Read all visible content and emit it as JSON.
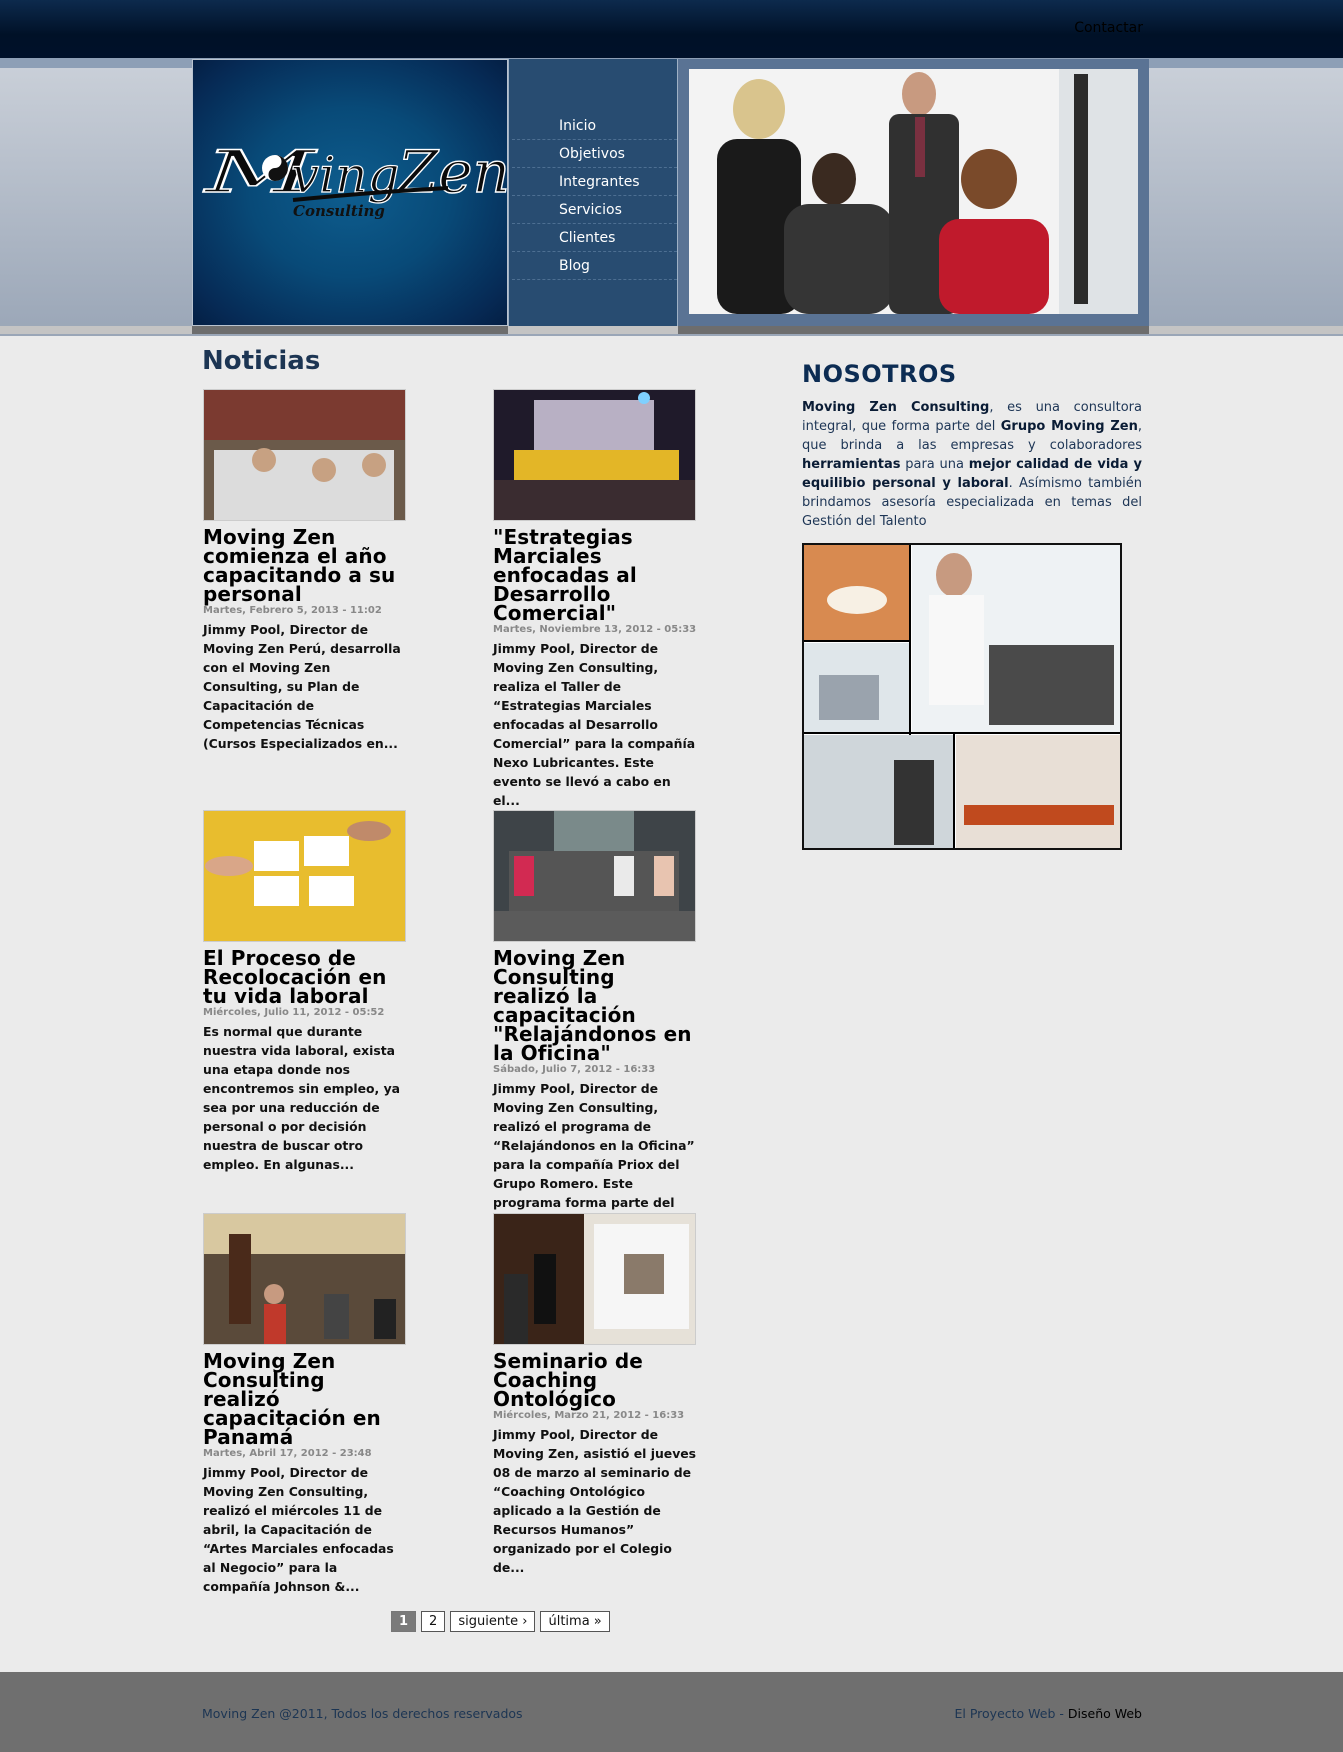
{
  "topbar": {
    "contact_label": "Contactar"
  },
  "logo": {
    "name": "Moving Zen",
    "tagline": "Consulting"
  },
  "nav": {
    "items": [
      {
        "label": "Inicio"
      },
      {
        "label": "Objetivos"
      },
      {
        "label": "Integrantes"
      },
      {
        "label": "Servicios"
      },
      {
        "label": "Clientes"
      },
      {
        "label": "Blog"
      }
    ]
  },
  "main": {
    "title": "Noticias",
    "posts": [
      {
        "title": "Moving Zen comienza el año capacitando a su personal",
        "date": "Martes, Febrero 5, 2013 - 11:02",
        "excerpt": "Jimmy Pool, Director de Moving Zen Perú, desarrolla con el Moving Zen Consulting, su Plan de Capacitación de Competencias Técnicas (Cursos Especializados en..."
      },
      {
        "title": "\"Estrategias Marciales enfocadas al Desarrollo Comercial\"",
        "date": "Martes, Noviembre 13, 2012 - 05:33",
        "excerpt": "Jimmy Pool, Director de Moving Zen Consulting, realiza el Taller de “Estrategias Marciales enfocadas al Desarrollo Comercial” para la compañía Nexo Lubricantes. Este evento se llevó a cabo en el..."
      },
      {
        "title": "El Proceso de Recolocación en tu vida laboral",
        "date": "Miércoles, Julio 11, 2012 - 05:52",
        "excerpt": "Es normal que durante nuestra vida laboral, exista una etapa donde nos encontremos sin empleo, ya sea por una reducción de personal o por decisión nuestra de buscar otro empleo. En algunas..."
      },
      {
        "title": "Moving Zen Consulting realizó la capacitación \"Relajándonos en la Oficina\"",
        "date": "Sábado, Julio 7, 2012 - 16:33",
        "excerpt": "Jimmy Pool, Director de Moving Zen Consulting, realizó el programa de “Relajándonos en la Oficina” para la compañía Priox del Grupo Romero. Este programa forma parte del plan..."
      },
      {
        "title": "Moving Zen Consulting realizó capacitación en Panamá",
        "date": "Martes, Abril 17, 2012 - 23:48",
        "excerpt": "Jimmy Pool, Director de Moving Zen Consulting, realizó el miércoles 11 de abril, la Capacitación de “Artes Marciales enfocadas al Negocio” para la compañía Johnson &..."
      },
      {
        "title": "Seminario de Coaching Ontológico",
        "date": "Miércoles, Marzo 21, 2012 - 16:33",
        "excerpt": "Jimmy Pool, Director de Moving Zen, asistió el jueves 08 de marzo al seminario de “Coaching Ontológico aplicado a la Gestión de Recursos Humanos” organizado por el Colegio de..."
      }
    ]
  },
  "pager": {
    "current": "1",
    "page2": "2",
    "next": "siguiente ›",
    "last": "última »"
  },
  "sidebar": {
    "title": "NOSOTROS",
    "p1": "Moving Zen Consulting",
    "p2": ", es una consultora integral, que forma parte del ",
    "p3": "Grupo Moving Zen",
    "p4": ", que brinda a las empresas y colaboradores ",
    "p5": "herramientas",
    "p6": " para una ",
    "p7": "mejor calidad de vida y equilibio personal y laboral",
    "p8": ". Asímismo también brindamos asesoría especializada en temas del Gestión del Talento"
  },
  "footer": {
    "copyright": "Moving Zen @2011, Todos los derechos reservados",
    "credit_link": "El Proyecto Web",
    "credit_sep": " - ",
    "credit_bold": "Diseño Web"
  }
}
